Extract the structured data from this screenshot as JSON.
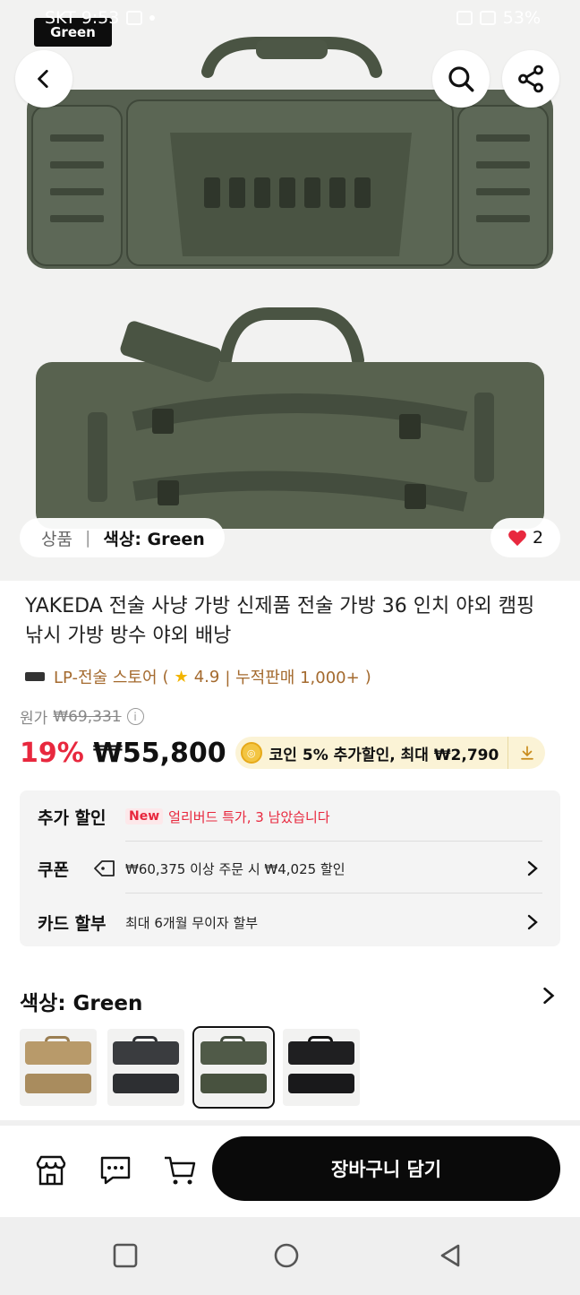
{
  "status_bar": {
    "carrier_time": "SKT 9:53",
    "battery": "53%"
  },
  "hero": {
    "color_tag": "Green",
    "category_label": "상품",
    "separator": "|",
    "selected_option": "색상: Green",
    "like_count": "2"
  },
  "product": {
    "title": "YAKEDA 전술 사냥 가방 신제품 전술 가방 36 인치 야외 캠핑 낚시 가방 방수 야외 배낭",
    "store_name": "LP-전술 스토어",
    "rating_open": "(",
    "rating": "4.9",
    "sales_label": "| 누적판매 1,000+",
    "rating_close": ")",
    "original_price_label": "원가",
    "original_price": "₩69,331",
    "discount_rate": "19%",
    "price": "₩55,800",
    "coin_text": "코인 5% 추가할인, 최대 ₩2,790"
  },
  "extra_discount": {
    "label": "추가 할인",
    "new_badge": "New",
    "early_bird_text": "얼리버드 특가, 3 남았습니다",
    "coupon_label": "쿠폰",
    "coupon_text": "₩60,375 이상 주문 시 ₩4,025 할인",
    "card_label": "카드 할부",
    "card_text": "최대 6개월 무이자 할부"
  },
  "options": {
    "title": "색상: Green",
    "swatches": [
      {
        "name": "tan",
        "color": "#b89a6a",
        "selected": false
      },
      {
        "name": "black-gray",
        "color": "#3a3c3f",
        "selected": false
      },
      {
        "name": "green",
        "color": "#505a48",
        "selected": true
      },
      {
        "name": "black",
        "color": "#1f1f21",
        "selected": false
      }
    ]
  },
  "bottom_bar": {
    "add_to_cart_label": "장바구니 담기"
  },
  "colors": {
    "accent_red": "#e8283e",
    "store_brown": "#a46a2e",
    "bag_green": "#4f5947"
  }
}
